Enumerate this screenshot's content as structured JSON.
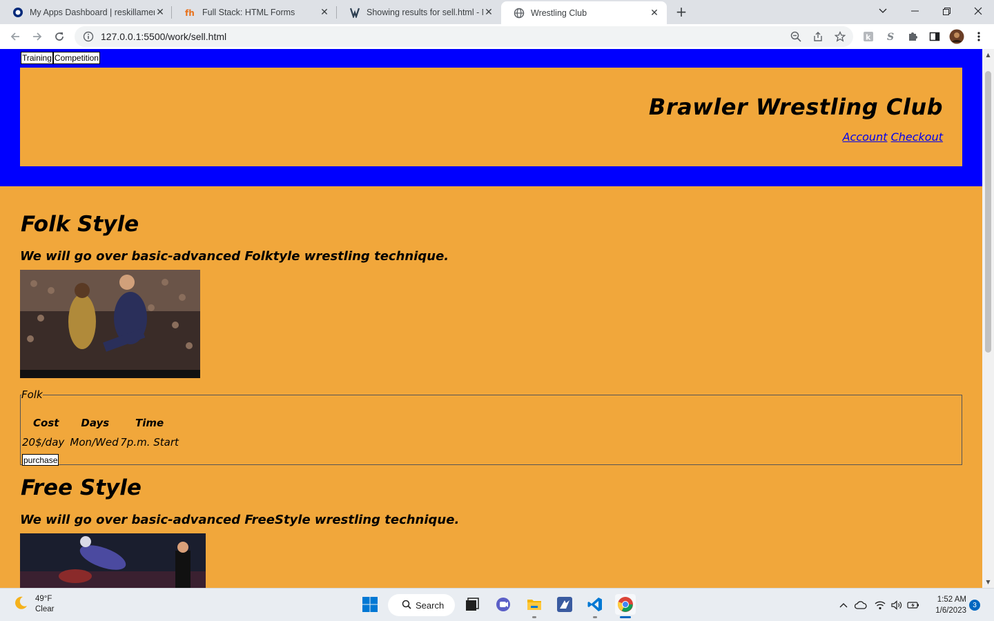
{
  "browser": {
    "tabs": [
      {
        "title": "My Apps Dashboard | reskillamer",
        "icon": "okta-icon",
        "active": false
      },
      {
        "title": "Full Stack: HTML Forms",
        "icon": "fh-icon",
        "active": false
      },
      {
        "title": "Showing results for sell.html - Nu",
        "icon": "validator-icon",
        "active": false
      },
      {
        "title": "Wrestling Club",
        "icon": "globe-icon",
        "active": true
      }
    ],
    "url": "127.0.0.1:5500/work/sell.html"
  },
  "page": {
    "nav": {
      "training": "Training",
      "competition": "Competition"
    },
    "site_title": "Brawler Wrestling Club",
    "links": {
      "account": "Account",
      "checkout": "Checkout"
    },
    "sections": [
      {
        "title": "Folk Style",
        "subtitle": "We will go over basic-advanced Folktyle wrestling technique.",
        "legend": "Folk",
        "headers": [
          "Cost",
          "Days",
          "Time"
        ],
        "values": [
          "20$/day",
          "Mon/Wed",
          "7p.m. Start"
        ],
        "button": "purchase"
      },
      {
        "title": "Free Style",
        "subtitle": "We will go over basic-advanced FreeStyle wrestling technique."
      }
    ]
  },
  "taskbar": {
    "weather": {
      "temp": "49°F",
      "condition": "Clear"
    },
    "search_label": "Search",
    "time": "1:52 AM",
    "date": "1/6/2023",
    "notifications": "3"
  },
  "colors": {
    "page_bg": "#f1a73b",
    "header_bg": "#0000ff"
  }
}
